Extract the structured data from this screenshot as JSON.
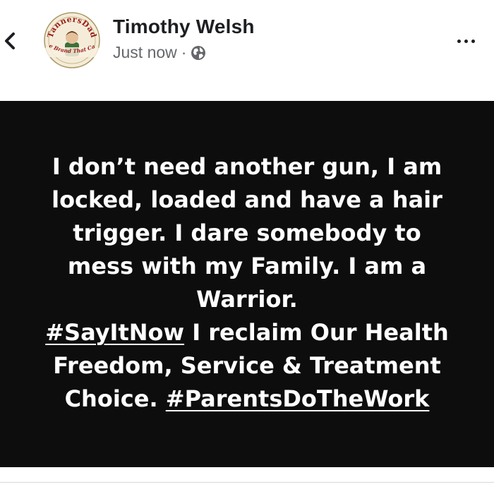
{
  "post": {
    "author": "Timothy Welsh",
    "time": "Just now",
    "separator": "·",
    "privacy_icon": "globe-icon",
    "avatar": {
      "top_text": "TannersDad",
      "bottom_text": "The Brand That Cares"
    },
    "icons": {
      "back": "chevron-left-icon",
      "more": "more-horizontal-icon"
    },
    "image_text": {
      "line1": "I don’t need another gun, I am",
      "line2": "locked, loaded and have a hair",
      "line3": "trigger. I dare somebody to",
      "line4": "mess with my Family. I am a",
      "line5": "Warrior.",
      "hashtag1": "#SayItNow",
      "line6_rest": " I reclaim Our Health",
      "line7": "Freedom, Service & Treatment",
      "line8_start": "Choice. ",
      "hashtag2": "#ParentsDoTheWork"
    }
  },
  "colors": {
    "image_background": "#0d0d0d",
    "author_text": "#1c1e21",
    "meta_text": "#65676b",
    "image_text": "#ffffff"
  }
}
